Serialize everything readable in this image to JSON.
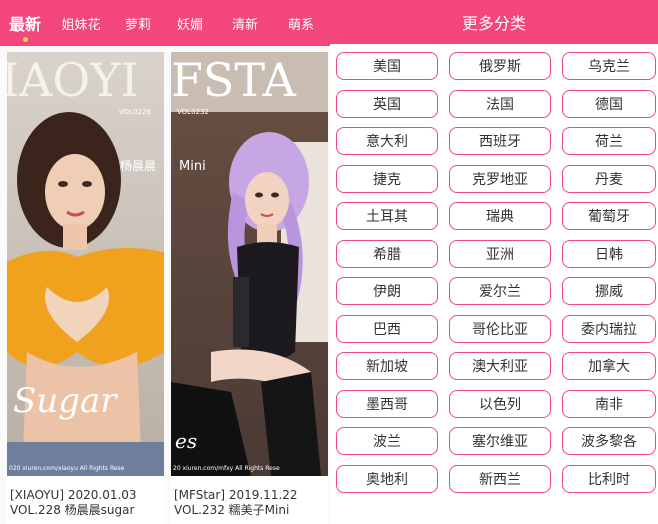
{
  "tabs": [
    {
      "label": "最新",
      "active": true
    },
    {
      "label": "姐妹花",
      "active": false
    },
    {
      "label": "萝莉",
      "active": false
    },
    {
      "label": "妖媚",
      "active": false
    },
    {
      "label": "清新",
      "active": false
    },
    {
      "label": "萌系",
      "active": false
    }
  ],
  "cards": [
    {
      "cover_banner": "IAOYI",
      "cover_code": "VOL0228",
      "cover_name": "杨晨晨",
      "cover_script": "Sugar",
      "cover_footer": "020 xiuren.com/xiaoyu All Rights Rese",
      "caption_line1": "[XIAOYU] 2020.01.03",
      "caption_line2": "VOL.228 杨晨晨sugar"
    },
    {
      "cover_banner": "FSTA",
      "cover_code": "VOL0232",
      "cover_name": "Mini",
      "cover_script": "es",
      "cover_footer": "20 xiuren.com/mfxy All Rights Rese",
      "caption_line1": "[MFStar] 2019.11.22",
      "caption_line2": "VOL.232 糯美子Mini"
    }
  ],
  "panel": {
    "title": "更多分类",
    "categories": [
      [
        "美国",
        "俄罗斯",
        "乌克兰"
      ],
      [
        "英国",
        "法国",
        "德国"
      ],
      [
        "意大利",
        "西班牙",
        "荷兰"
      ],
      [
        "捷克",
        "克罗地亚",
        "丹麦"
      ],
      [
        "土耳其",
        "瑞典",
        "葡萄牙"
      ],
      [
        "希腊",
        "亚洲",
        "日韩"
      ],
      [
        "伊朗",
        "爱尔兰",
        "挪威"
      ],
      [
        "巴西",
        "哥伦比亚",
        "委内瑞拉"
      ],
      [
        "新加坡",
        "澳大利亚",
        "加拿大"
      ],
      [
        "墨西哥",
        "以色列",
        "南非"
      ],
      [
        "波兰",
        "塞尔维亚",
        "波多黎各"
      ],
      [
        "奥地利",
        "新西兰",
        "比利时"
      ]
    ]
  },
  "colors": {
    "accent": "#f2467c",
    "tab_indicator": "#ffd64d"
  }
}
